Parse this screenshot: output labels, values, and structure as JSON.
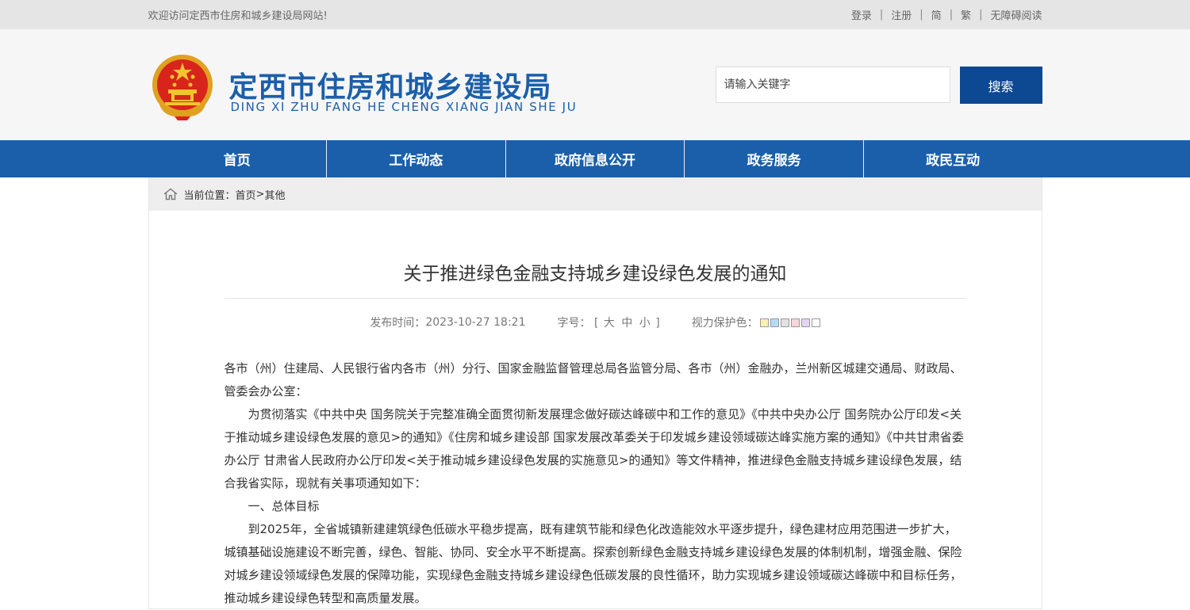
{
  "topbar": {
    "welcome": "欢迎访问定西市住房和城乡建设局网站!",
    "links": [
      "登录",
      "注册",
      "简",
      "繁",
      "无障碍阅读"
    ]
  },
  "header": {
    "title": "定西市住房和城乡建设局",
    "subtitle": "DING XI ZHU FANG HE CHENG XIANG JIAN SHE JU",
    "search_placeholder": "请输入关键字",
    "search_button": "搜索"
  },
  "nav": [
    "首页",
    "工作动态",
    "政府信息公开",
    "政务服务",
    "政民互动"
  ],
  "breadcrumb": {
    "label": "当前位置：",
    "home": "首页",
    "sep": ">",
    "current": "其他"
  },
  "article": {
    "title": "关于推进绿色金融支持城乡建设绿色发展的通知",
    "publish_label": "发布时间：",
    "publish_time": "2023-10-27 18:21",
    "fontsize_label": "字号：",
    "fontsize_open": "[",
    "fontsize_options": [
      "大",
      "中",
      "小"
    ],
    "fontsize_close": "]",
    "eye_label": "视力保护色：",
    "eye_colors": [
      "#faf0b4",
      "#b8daf5",
      "#e2e2e2",
      "#f6d7de",
      "#e4d3f3",
      "#ffffff"
    ],
    "paragraphs": [
      "各市（州）住建局、人民银行省内各市（州）分行、国家金融监督管理总局各监管分局、各市（州）金融办，兰州新区城建交通局、财政局、管委会办公室：",
      "为贯彻落实《中共中央 国务院关于完整准确全面贯彻新发展理念做好碳达峰碳中和工作的意见》《中共中央办公厅 国务院办公厅印发<关于推动城乡建设绿色发展的意见>的通知》《住房和城乡建设部 国家发展改革委关于印发城乡建设领域碳达峰实施方案的通知》《中共甘肃省委办公厅 甘肃省人民政府办公厅印发<关于推动城乡建设绿色发展的实施意见>的通知》等文件精神，推进绿色金融支持城乡建设绿色发展，结合我省实际，现就有关事项通知如下：",
      "一、总体目标",
      "到2025年，全省城镇新建建筑绿色低碳水平稳步提高，既有建筑节能和绿色化改造能效水平逐步提升，绿色建材应用范围进一步扩大，城镇基础设施建设不断完善，绿色、智能、协同、安全水平不断提高。探索创新绿色金融支持城乡建设绿色发展的体制机制，增强金融、保险对城乡建设领域绿色发展的保障功能，实现绿色金融支持城乡建设绿色低碳发展的良性循环，助力实现城乡建设领域碳达峰碳中和目标任务，推动城乡建设绿色转型和高质量发展。"
    ]
  }
}
